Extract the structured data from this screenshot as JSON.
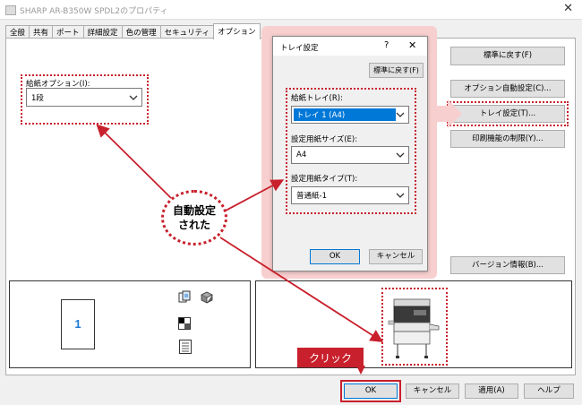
{
  "window": {
    "title": "SHARP AR-B350W SPDL2のプロパティ",
    "close_glyph": "✕"
  },
  "tabs": [
    "全般",
    "共有",
    "ポート",
    "詳細設定",
    "色の管理",
    "セキュリティ",
    "オプション"
  ],
  "options_tab": {
    "paper_option_label": "給紙オプション(I):",
    "paper_option_value": "1段",
    "buttons": {
      "reset": "標準に戻す(F)",
      "auto_config": "オプション自動設定(C)...",
      "tray_settings": "トレイ設定(T)...",
      "print_restrict": "印刷機能の制限(Y)...",
      "version": "バージョン情報(B)..."
    },
    "preview_number": "1"
  },
  "tray_dialog": {
    "title": "トレイ設定",
    "help_glyph": "?",
    "close_glyph": "✕",
    "reset_button": "標準に戻す(F)",
    "feed_tray_label": "給紙トレイ(R):",
    "feed_tray_value": "トレイ 1 (A4)",
    "paper_size_label": "設定用紙サイズ(E):",
    "paper_size_value": "A4",
    "paper_type_label": "設定用紙タイプ(T):",
    "paper_type_value": "普通紙-1",
    "ok_button": "OK",
    "cancel_button": "キャンセル"
  },
  "annotations": {
    "callout_line1": "自動設定",
    "callout_line2": "された",
    "click_label": "クリック",
    "accent_color": "#c8202c"
  },
  "footer": {
    "ok": "OK",
    "cancel": "キャンセル",
    "apply": "適用(A)",
    "help": "ヘルプ"
  }
}
